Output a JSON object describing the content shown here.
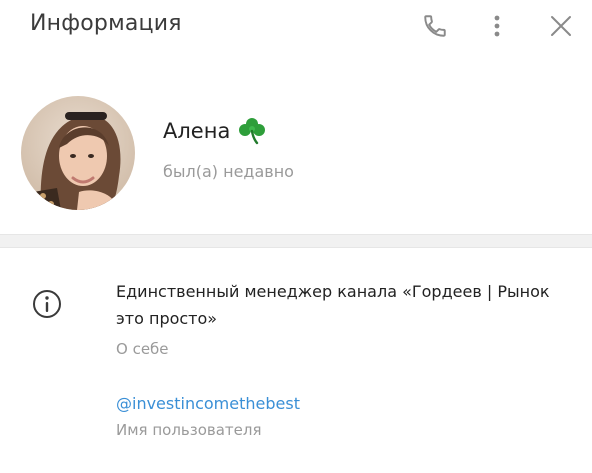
{
  "header": {
    "title": "Информация",
    "icons": [
      "phone-icon",
      "more-vertical-icon",
      "close-icon"
    ]
  },
  "profile": {
    "name": "Алена",
    "emoji": "🍀",
    "status": "был(а) недавно"
  },
  "info": {
    "bio": "Единственный менеджер канала «Гордеев | Рынок это просто»",
    "bio_label": "О себе",
    "username": "@investincomethebest",
    "username_label": "Имя пользователя"
  },
  "colors": {
    "accent": "#3a8fd6",
    "secondary_text": "#9a9a9a",
    "icon": "#8a8a8a"
  }
}
